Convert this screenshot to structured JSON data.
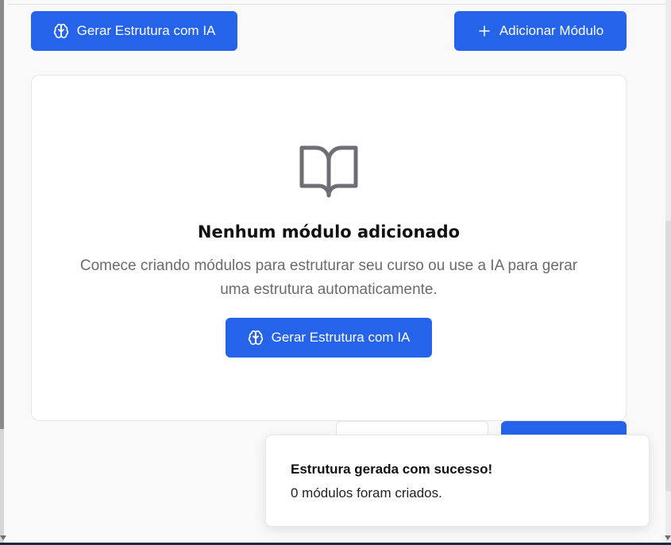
{
  "toolbar": {
    "generate_ai_label": "Gerar Estrutura com IA",
    "add_module_label": "Adicionar Módulo"
  },
  "empty_state": {
    "icon": "book-open-icon",
    "title": "Nenhum módulo adicionado",
    "description": "Comece criando módulos para estruturar seu curso ou use a IA para gerar uma estrutura automaticamente.",
    "generate_ai_label": "Gerar Estrutura com IA"
  },
  "toast": {
    "title": "Estrutura gerada com sucesso!",
    "description": "0 módulos foram criados."
  },
  "colors": {
    "primary": "#2563eb",
    "muted_text": "#6b6b6b",
    "icon": "#6e6e76"
  }
}
